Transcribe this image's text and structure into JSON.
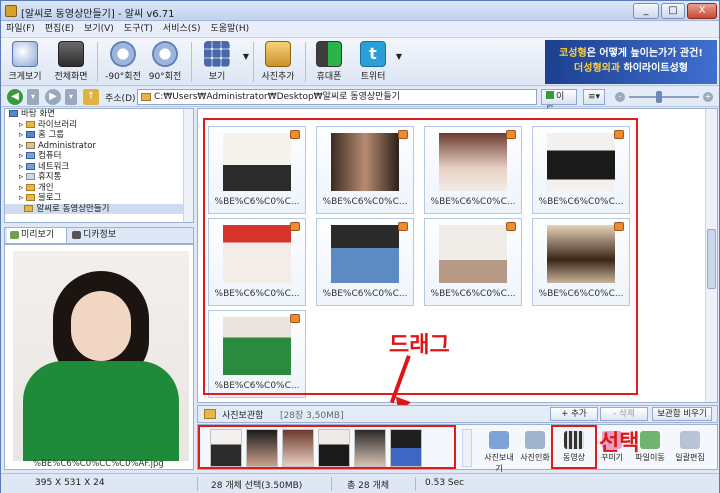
{
  "window": {
    "title": "[알씨로 동영상만들기] - 알씨 v6.71",
    "controls": [
      "_",
      "□",
      "X"
    ]
  },
  "menu": [
    "파일(F)",
    "편집(E)",
    "보기(V)",
    "도구(T)",
    "서비스(S)",
    "도움말(H)"
  ],
  "toolbar": {
    "buttons": [
      {
        "label": "크게보기",
        "icon": "magnifier-icon"
      },
      {
        "label": "전체화면",
        "icon": "fullscreen-icon"
      },
      {
        "label": "-90°회전",
        "icon": "rotate-left-icon"
      },
      {
        "label": "90°회전",
        "icon": "rotate-right-icon"
      },
      {
        "label": "보기",
        "icon": "view-grid-icon"
      },
      {
        "label": "사진추가",
        "icon": "photo-add-icon"
      },
      {
        "label": "휴대폰",
        "icon": "phone-export-icon"
      },
      {
        "label": "트위터",
        "icon": "twitter-icon"
      }
    ],
    "ad": {
      "highlight1": "코성형",
      "line1_rest": "은 어떻게 높이는가가 관건!",
      "highlight2": "더성형외과",
      "line2_rest": " 하이라이트성형"
    }
  },
  "address": {
    "label": "주소(D)",
    "path": "C:₩Users₩Administrator₩Desktop₩알씨로 동영상만들기",
    "go_label": "이동"
  },
  "tree": {
    "items": [
      {
        "label": "바탕 화면",
        "indent": 0
      },
      {
        "label": "라이브러리",
        "indent": 1
      },
      {
        "label": "홈 그룹",
        "indent": 1
      },
      {
        "label": "Administrator",
        "indent": 1
      },
      {
        "label": "컴퓨터",
        "indent": 1
      },
      {
        "label": "네트워크",
        "indent": 1
      },
      {
        "label": "휴지통",
        "indent": 1
      },
      {
        "label": "개인",
        "indent": 1
      },
      {
        "label": "블로그",
        "indent": 1
      },
      {
        "label": "알씨로 동영상만들기",
        "indent": 1
      }
    ]
  },
  "preview": {
    "tabs": [
      "미리보기",
      "디카정보"
    ],
    "caption": "%BE%C6%C0%CC%C0%AF.jpg"
  },
  "grid": {
    "label": "%BE%C6%C0%C...",
    "count": 9
  },
  "annotations": {
    "drag": "드래그",
    "select": "선택"
  },
  "photobox": {
    "title": "사진보관함",
    "count": "[28장 3,50MB]",
    "add_label": "+ 추가",
    "delete_label": "- 삭제",
    "empty_label": "보관함 비우기",
    "actions": [
      "사진보내기",
      "사진인화",
      "동영상",
      "꾸미기",
      "파일이동",
      "일괄편집"
    ]
  },
  "status": {
    "dimensions": "395 X 531 X 24",
    "selection": "28 개체 선택(3.50MB)",
    "total": "총 28 개체",
    "time": "0.53 Sec"
  },
  "colors": {
    "accent_red": "#e21a1a",
    "folder": "#e7b748",
    "twitter": "#2a9fd8"
  }
}
